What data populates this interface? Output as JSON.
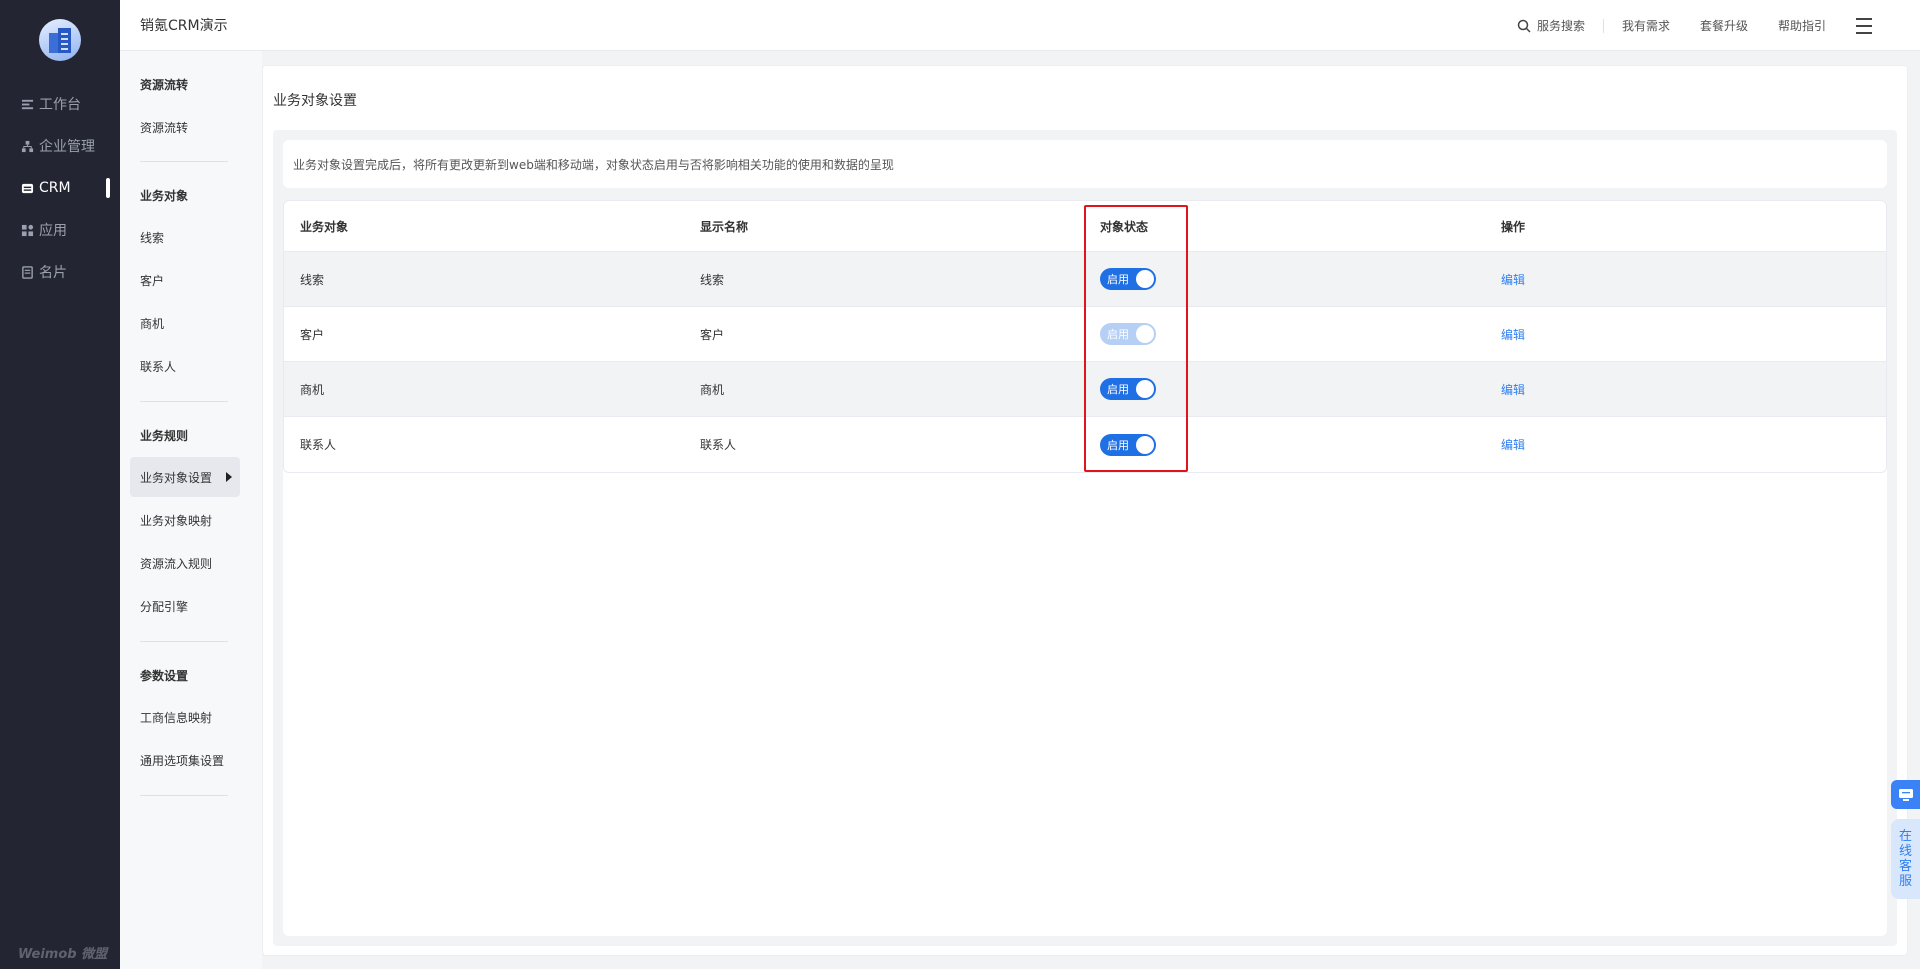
{
  "nav": {
    "items": [
      {
        "label": "工作台",
        "icon": "dashboard-icon"
      },
      {
        "label": "企业管理",
        "icon": "org-chart-icon"
      },
      {
        "label": "CRM",
        "icon": "crm-icon"
      },
      {
        "label": "应用",
        "icon": "apps-icon"
      },
      {
        "label": "名片",
        "icon": "card-icon"
      }
    ],
    "brand": "Weimob 微盟"
  },
  "topbar": {
    "title": "销氪CRM演示",
    "search": "服务搜索",
    "my_needs": "我有需求",
    "upgrade": "套餐升级",
    "help": "帮助指引"
  },
  "subnav": {
    "groups": [
      {
        "title": "资源流转",
        "items": [
          "资源流转"
        ]
      },
      {
        "title": "业务对象",
        "items": [
          "线索",
          "客户",
          "商机",
          "联系人"
        ]
      },
      {
        "title": "业务规则",
        "items": [
          "业务对象设置",
          "业务对象映射",
          "资源流入规则",
          "分配引擎"
        ]
      },
      {
        "title": "参数设置",
        "items": [
          "工商信息映射",
          "通用选项集设置"
        ]
      }
    ]
  },
  "page": {
    "title": "业务对象设置",
    "tip": "业务对象设置完成后，将所有更改更新到web端和移动端，对象状态启用与否将影响相关功能的使用和数据的呈现",
    "table": {
      "headers": [
        "业务对象",
        "显示名称",
        "对象状态",
        "操作"
      ],
      "rows": [
        {
          "object": "线索",
          "display": "线索",
          "status": "启用",
          "action": "编辑"
        },
        {
          "object": "客户",
          "display": "客户",
          "status": "启用",
          "action": "编辑"
        },
        {
          "object": "商机",
          "display": "商机",
          "status": "启用",
          "action": "编辑"
        },
        {
          "object": "联系人",
          "display": "联系人",
          "status": "启用",
          "action": "编辑"
        }
      ]
    }
  },
  "float": {
    "service": [
      "在",
      "线",
      "客",
      "服"
    ]
  },
  "colors": {
    "accent": "#1f6fe5",
    "nav_bg": "#232632",
    "highlight": "#e2141b"
  }
}
